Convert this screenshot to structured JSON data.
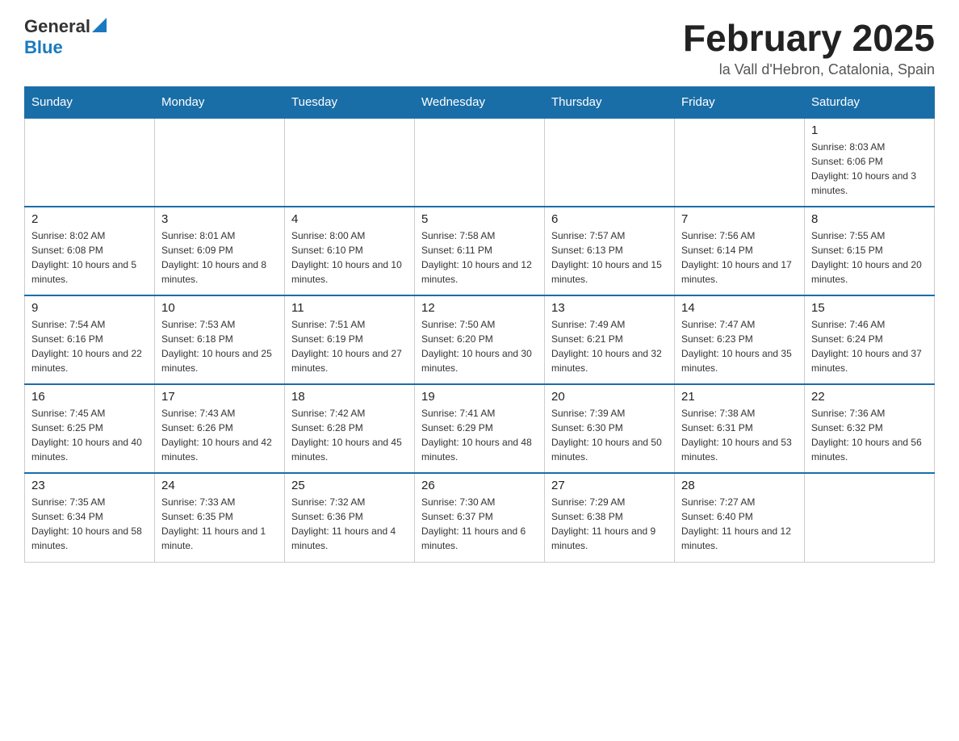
{
  "logo": {
    "general": "General",
    "blue": "Blue"
  },
  "header": {
    "title": "February 2025",
    "location": "la Vall d'Hebron, Catalonia, Spain"
  },
  "weekdays": [
    "Sunday",
    "Monday",
    "Tuesday",
    "Wednesday",
    "Thursday",
    "Friday",
    "Saturday"
  ],
  "weeks": [
    [
      {
        "day": "",
        "info": ""
      },
      {
        "day": "",
        "info": ""
      },
      {
        "day": "",
        "info": ""
      },
      {
        "day": "",
        "info": ""
      },
      {
        "day": "",
        "info": ""
      },
      {
        "day": "",
        "info": ""
      },
      {
        "day": "1",
        "info": "Sunrise: 8:03 AM\nSunset: 6:06 PM\nDaylight: 10 hours and 3 minutes."
      }
    ],
    [
      {
        "day": "2",
        "info": "Sunrise: 8:02 AM\nSunset: 6:08 PM\nDaylight: 10 hours and 5 minutes."
      },
      {
        "day": "3",
        "info": "Sunrise: 8:01 AM\nSunset: 6:09 PM\nDaylight: 10 hours and 8 minutes."
      },
      {
        "day": "4",
        "info": "Sunrise: 8:00 AM\nSunset: 6:10 PM\nDaylight: 10 hours and 10 minutes."
      },
      {
        "day": "5",
        "info": "Sunrise: 7:58 AM\nSunset: 6:11 PM\nDaylight: 10 hours and 12 minutes."
      },
      {
        "day": "6",
        "info": "Sunrise: 7:57 AM\nSunset: 6:13 PM\nDaylight: 10 hours and 15 minutes."
      },
      {
        "day": "7",
        "info": "Sunrise: 7:56 AM\nSunset: 6:14 PM\nDaylight: 10 hours and 17 minutes."
      },
      {
        "day": "8",
        "info": "Sunrise: 7:55 AM\nSunset: 6:15 PM\nDaylight: 10 hours and 20 minutes."
      }
    ],
    [
      {
        "day": "9",
        "info": "Sunrise: 7:54 AM\nSunset: 6:16 PM\nDaylight: 10 hours and 22 minutes."
      },
      {
        "day": "10",
        "info": "Sunrise: 7:53 AM\nSunset: 6:18 PM\nDaylight: 10 hours and 25 minutes."
      },
      {
        "day": "11",
        "info": "Sunrise: 7:51 AM\nSunset: 6:19 PM\nDaylight: 10 hours and 27 minutes."
      },
      {
        "day": "12",
        "info": "Sunrise: 7:50 AM\nSunset: 6:20 PM\nDaylight: 10 hours and 30 minutes."
      },
      {
        "day": "13",
        "info": "Sunrise: 7:49 AM\nSunset: 6:21 PM\nDaylight: 10 hours and 32 minutes."
      },
      {
        "day": "14",
        "info": "Sunrise: 7:47 AM\nSunset: 6:23 PM\nDaylight: 10 hours and 35 minutes."
      },
      {
        "day": "15",
        "info": "Sunrise: 7:46 AM\nSunset: 6:24 PM\nDaylight: 10 hours and 37 minutes."
      }
    ],
    [
      {
        "day": "16",
        "info": "Sunrise: 7:45 AM\nSunset: 6:25 PM\nDaylight: 10 hours and 40 minutes."
      },
      {
        "day": "17",
        "info": "Sunrise: 7:43 AM\nSunset: 6:26 PM\nDaylight: 10 hours and 42 minutes."
      },
      {
        "day": "18",
        "info": "Sunrise: 7:42 AM\nSunset: 6:28 PM\nDaylight: 10 hours and 45 minutes."
      },
      {
        "day": "19",
        "info": "Sunrise: 7:41 AM\nSunset: 6:29 PM\nDaylight: 10 hours and 48 minutes."
      },
      {
        "day": "20",
        "info": "Sunrise: 7:39 AM\nSunset: 6:30 PM\nDaylight: 10 hours and 50 minutes."
      },
      {
        "day": "21",
        "info": "Sunrise: 7:38 AM\nSunset: 6:31 PM\nDaylight: 10 hours and 53 minutes."
      },
      {
        "day": "22",
        "info": "Sunrise: 7:36 AM\nSunset: 6:32 PM\nDaylight: 10 hours and 56 minutes."
      }
    ],
    [
      {
        "day": "23",
        "info": "Sunrise: 7:35 AM\nSunset: 6:34 PM\nDaylight: 10 hours and 58 minutes."
      },
      {
        "day": "24",
        "info": "Sunrise: 7:33 AM\nSunset: 6:35 PM\nDaylight: 11 hours and 1 minute."
      },
      {
        "day": "25",
        "info": "Sunrise: 7:32 AM\nSunset: 6:36 PM\nDaylight: 11 hours and 4 minutes."
      },
      {
        "day": "26",
        "info": "Sunrise: 7:30 AM\nSunset: 6:37 PM\nDaylight: 11 hours and 6 minutes."
      },
      {
        "day": "27",
        "info": "Sunrise: 7:29 AM\nSunset: 6:38 PM\nDaylight: 11 hours and 9 minutes."
      },
      {
        "day": "28",
        "info": "Sunrise: 7:27 AM\nSunset: 6:40 PM\nDaylight: 11 hours and 12 minutes."
      },
      {
        "day": "",
        "info": ""
      }
    ]
  ]
}
